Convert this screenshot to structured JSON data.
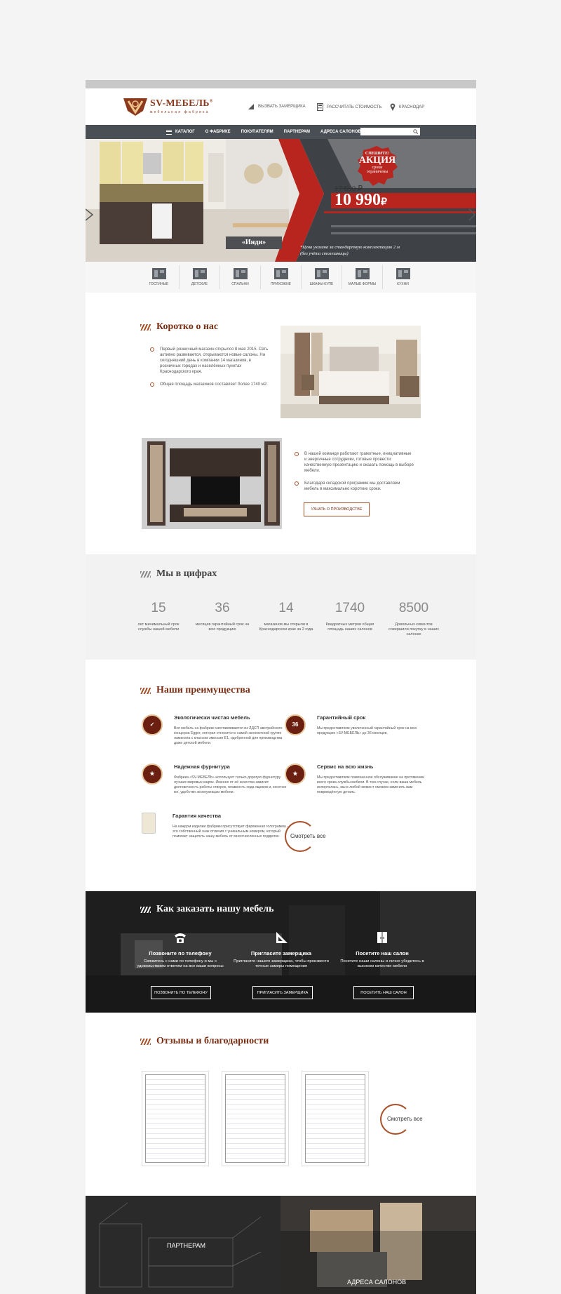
{
  "brand": {
    "name": "SV-МЕБЕЛЬ",
    "tagline": "мебельная фабрика",
    "registered": "®",
    "colors": {
      "accent": "#a8502a",
      "brand": "#7b2e14",
      "nav": "#4a4f55",
      "promo": "#b8241e"
    }
  },
  "header": {
    "links": [
      {
        "label": "ВЫЗВАТЬ ЗАМЕРЩИКА",
        "icon": "ruler-icon"
      },
      {
        "label": "РАССЧИТАТЬ СТОИМОСТЬ",
        "icon": "calculator-icon"
      },
      {
        "label": "КРАСНОДАР",
        "icon": "location-pin-icon"
      }
    ]
  },
  "nav": {
    "items": [
      "КАТАЛОГ",
      "О ФАБРИКЕ",
      "ПОКУПАТЕЛЯМ",
      "ПАРТНЕРАМ",
      "АДРЕСА САЛОНОВ"
    ],
    "search_placeholder": ""
  },
  "hero": {
    "badge_top": "СПЕШИТЕ!",
    "badge_main": "АКЦИЯ",
    "badge_bottom": "сроки ограничены",
    "old_price": "17 690 ₽",
    "new_price": "10 990",
    "currency": "₽",
    "product": "«Инди»",
    "note_line1": "*Цена указана за стандартную комплектацию 2 м",
    "note_line2": "(без учёта столешницы)"
  },
  "categories": [
    "ГОСТИНЫЕ",
    "ДЕТСКИЕ",
    "СПАЛЬНИ",
    "ПРИХОЖИЕ",
    "ШКАФЫ-КУПЕ",
    "МАЛЫЕ ФОРМЫ",
    "КУХНИ"
  ],
  "about": {
    "title": "Коротко о нас",
    "bullets1": [
      "Первый розничный магазин открылся 8 мая 2015. Сеть активно развивается, открываются новые салоны. На сегодняшний день в компании 14 магазинов, в розничных городах и населённых пунктах Краснодарского края.",
      "Общая площадь магазинов составляет более 1740 м2."
    ],
    "bullets2": [
      "В нашей команде работают грамотные, инициативные и энергичные сотрудники, готовые провести качественную презентацию и оказать помощь в выборе мебели.",
      "Благодаря складской программе мы доставляем мебель в максимально короткие сроки."
    ],
    "button": "УЗНАТЬ О ПРОИЗВОДСТВЕ"
  },
  "stats": {
    "title": "Мы в цифрах",
    "items": [
      {
        "value": "15",
        "label": "лет минимальный срок службы нашей мебели"
      },
      {
        "value": "36",
        "label": "месяцев гарантийный срок на всю продукцию"
      },
      {
        "value": "14",
        "label": "магазинов мы открыли в Краснодарском крае за 2 года"
      },
      {
        "value": "1740",
        "label": "Квадратных метров общая площадь наших салонов"
      },
      {
        "value": "8500",
        "label": "Довольных клиентов совершили покупку в наших салонах"
      }
    ]
  },
  "advantages": {
    "title": "Наши преимущества",
    "items": [
      {
        "title": "Экологически чистая мебель",
        "text": "Вся мебель на фабрике изготавливается из ЛДСП австрийского концерна Egger, которая относится к самой экологичной группе ламината с классом эмиссии E1, одобренной для производства даже детской мебели.",
        "icon": "eco-seal-icon"
      },
      {
        "title": "Гарантийный срок",
        "text": "Мы предоставляем увеличенный гарантийный срок на всю продукцию «SV-МЕБЕЛЬ» до 36 месяцев.",
        "icon": "warranty-36-icon",
        "badge": "36"
      },
      {
        "title": "Надежная фурнитура",
        "text": "Фабрика «SV-МЕБЕЛЬ» использует только дорогую фурнитуру лучших мировых марок. Именно от её качества зависит долговечность работы створок, плавность хода ящиков и, конечно же, удобство эксплуатации мебели.",
        "icon": "hardware-seal-icon"
      },
      {
        "title": "Сервис на всю жизнь",
        "text": "Мы предоставляем пожизненное обслуживание на протяжении всего срока службы мебели. В том случае, если ваша мебель испортилась, мы в любой момент сможем заменить вам повреждённую деталь.",
        "icon": "service-seal-icon"
      },
      {
        "title": "Гарантия качества",
        "text": "На каждом изделии фабрики присутствует фирменная голограмма - это собственный знак отличия с уникальным номером, который помогает защитить нашу мебель от многочисленных подделок.",
        "icon": "hologram-icon"
      }
    ],
    "see_all": "Смотреть все"
  },
  "order": {
    "title": "Как заказать нашу мебель",
    "steps": [
      {
        "title": "Позвоните по телефону",
        "text": "Свяжитесь с нами по телефону и мы с удовольствием ответим на все ваши вопросы",
        "button": "ПОЗВОНИТЬ ПО ТЕЛЕФОНУ",
        "icon": "phone-icon"
      },
      {
        "title": "Пригласите замерщика",
        "text": "Пригласите нашего замерщика, чтобы произвести точные замеры помещения",
        "button": "ПРИГЛАСИТЬ ЗАМЕРЩИКА",
        "icon": "set-square-icon"
      },
      {
        "title": "Посетите наш салон",
        "text": "Посетите наши салоны и лично убедитесь в высоком качестве мебели",
        "button": "ПОСЕТИТЬ НАШ САЛОН",
        "icon": "wardrobe-icon"
      }
    ]
  },
  "reviews": {
    "title": "Отзывы и благодарности",
    "see_all": "Смотреть все"
  },
  "bottom": {
    "partners": "ПАРТНЕРАМ",
    "salons": "АДРЕСА САЛОНОВ"
  }
}
